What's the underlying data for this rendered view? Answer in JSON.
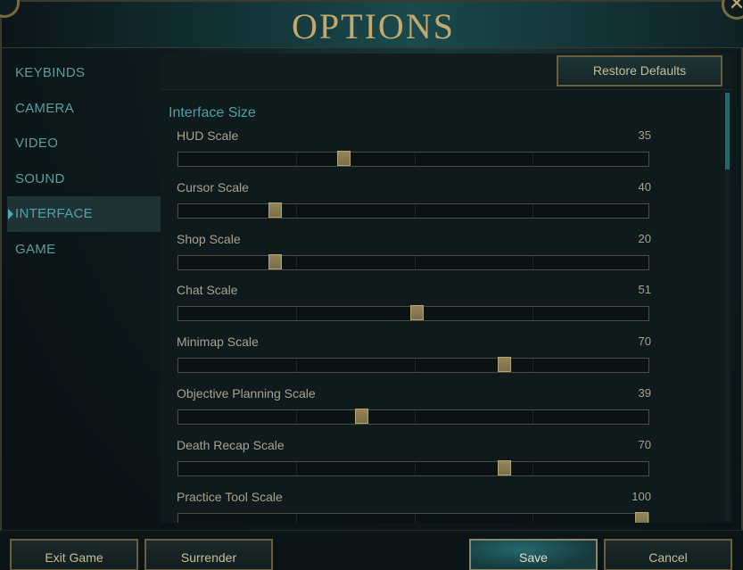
{
  "window": {
    "title": "OPTIONS",
    "close_glyph": "✕"
  },
  "sidebar": {
    "items": [
      {
        "label": "KEYBINDS"
      },
      {
        "label": "CAMERA"
      },
      {
        "label": "VIDEO"
      },
      {
        "label": "SOUND"
      },
      {
        "label": "INTERFACE"
      },
      {
        "label": "GAME"
      }
    ],
    "active_index": 4
  },
  "panel": {
    "restore_label": "Restore Defaults",
    "section_title": "Interface Size",
    "settings": [
      {
        "label": "HUD Scale",
        "value": "35",
        "level": 35
      },
      {
        "label": "Cursor Scale",
        "value": "40",
        "level": 20
      },
      {
        "label": "Shop Scale",
        "value": "20",
        "level": 20
      },
      {
        "label": "Chat Scale",
        "value": "51",
        "level": 51
      },
      {
        "label": "Minimap Scale",
        "value": "70",
        "level": 70
      },
      {
        "label": "Objective Planning Scale",
        "value": "39",
        "level": 39
      },
      {
        "label": "Death Recap Scale",
        "value": "70",
        "level": 70
      },
      {
        "label": "Practice Tool Scale",
        "value": "100",
        "level": 100
      }
    ]
  },
  "footer": {
    "exit_label": "Exit Game",
    "surrender_label": "Surrender",
    "save_label": "Save",
    "cancel_label": "Cancel"
  },
  "colors": {
    "gold": "#c3a96c",
    "teal_text": "#5f9c9e",
    "accent_teal": "#3cb3bf",
    "label_text": "#a7a38f"
  }
}
